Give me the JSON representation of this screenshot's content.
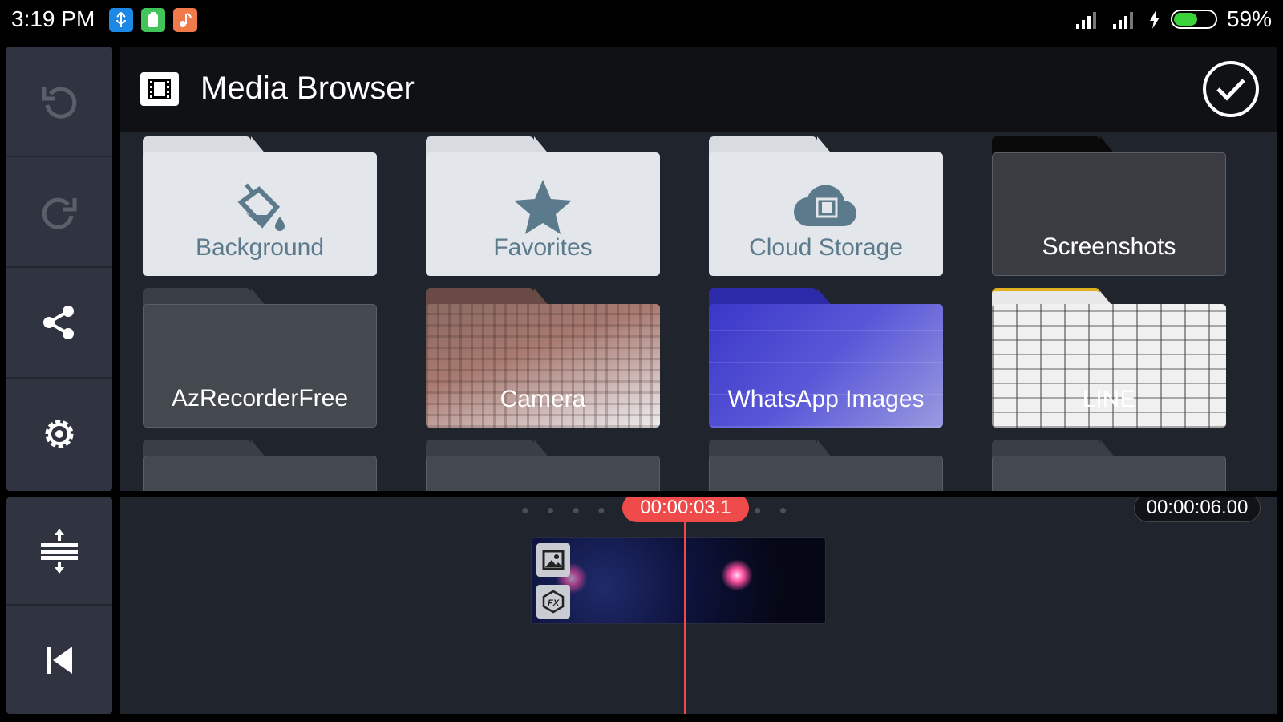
{
  "status_bar": {
    "time": "3:19 PM",
    "battery_percent": "59%",
    "battery_level": 0.59
  },
  "colors": {
    "accent": "#f04b4b",
    "folder_light": "#e3e6ea",
    "folder_label": "#5b7a8c",
    "panel": "#20242c",
    "sidebar": "#2f3440"
  },
  "sidebar": {
    "buttons": [
      {
        "icon": "undo-icon"
      },
      {
        "icon": "redo-icon"
      },
      {
        "icon": "share-icon"
      },
      {
        "icon": "gear-icon"
      }
    ],
    "bottom_buttons": [
      {
        "icon": "expand-timeline-icon"
      },
      {
        "icon": "skip-to-start-icon"
      }
    ]
  },
  "media_browser": {
    "title": "Media Browser",
    "folders": [
      {
        "label": "Background",
        "icon": "paint-bucket-icon"
      },
      {
        "label": "Favorites",
        "icon": "star-icon"
      },
      {
        "label": "Cloud Storage",
        "icon": "cloud-icon"
      },
      {
        "label": "Screenshots"
      },
      {
        "label": "AzRecorderFree"
      },
      {
        "label": "Camera"
      },
      {
        "label": "WhatsApp Images"
      },
      {
        "label": "LINE"
      }
    ]
  },
  "timeline": {
    "current_time": "00:00:03.1",
    "total_time": "00:00:06.00"
  }
}
